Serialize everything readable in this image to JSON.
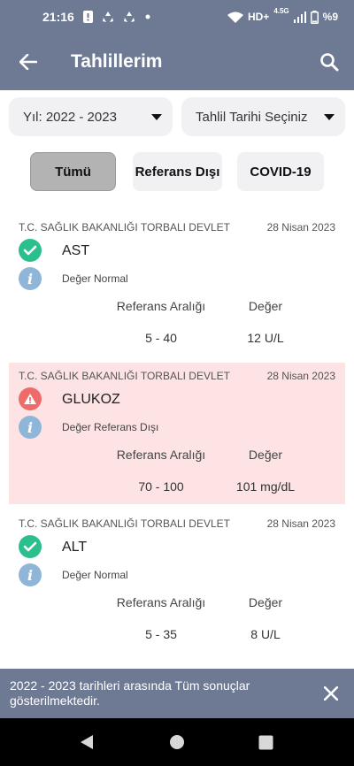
{
  "status_bar": {
    "time": "21:16",
    "network": "HD+",
    "network_sup": "4.5G",
    "battery": "%9",
    "icons": [
      "alert-icon",
      "recycle-icon",
      "recycle-icon",
      "dot-icon",
      "wifi-icon",
      "signal-icon",
      "battery-icon"
    ]
  },
  "app_bar": {
    "title": "Tahlillerim",
    "back_icon": "arrow-left-icon",
    "search_icon": "search-icon"
  },
  "filters": {
    "year": "Yıl: 2022 - 2023",
    "date_select": "Tahlil Tarihi Seçiniz"
  },
  "tabs": [
    {
      "label": "Tümü",
      "active": true
    },
    {
      "label": "Referans Dışı",
      "active": false
    },
    {
      "label": "COVID-19",
      "active": false
    }
  ],
  "results": [
    {
      "institution": "T.C. SAĞLIK BAKANLIĞI TORBALI DEVLET",
      "date": "28 Nisan 2023",
      "test": "AST",
      "status": "Değer Normal",
      "status_type": "normal",
      "ref_header": "Referans Aralığı",
      "value_header": "Değer",
      "ref_range": "5 - 40",
      "value": "12 U/L"
    },
    {
      "institution": "T.C. SAĞLIK BAKANLIĞI TORBALI DEVLET",
      "date": "28 Nisan 2023",
      "test": "GLUKOZ",
      "status": "Değer Referans Dışı",
      "status_type": "alert",
      "ref_header": "Referans Aralığı",
      "value_header": "Değer",
      "ref_range": "70 - 100",
      "value": "101 mg/dL"
    },
    {
      "institution": "T.C. SAĞLIK BAKANLIĞI TORBALI DEVLET",
      "date": "28 Nisan 2023",
      "test": "ALT",
      "status": "Değer Normal",
      "status_type": "normal",
      "ref_header": "Referans Aralığı",
      "value_header": "Değer",
      "ref_range": "5 - 35",
      "value": "8 U/L"
    }
  ],
  "snackbar": {
    "message": "2022 - 2023 tarihleri arasında Tüm sonuçlar gösterilmektedir."
  },
  "colors": {
    "primary": "#6e7a93",
    "normal": "#2cbf8e",
    "alert": "#ef6b6b",
    "alert_bg": "#fde3e3",
    "info": "#8fb6d8"
  }
}
